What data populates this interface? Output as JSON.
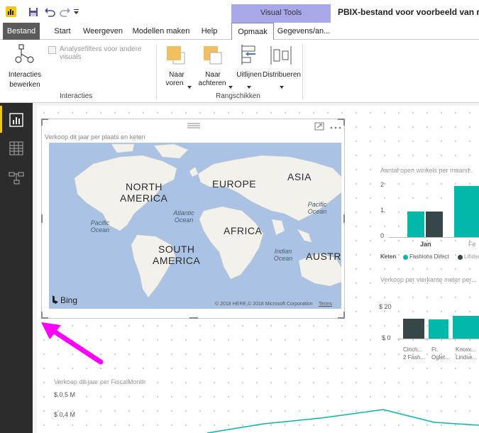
{
  "quick_access": {
    "app_icon": "power-bi-icon",
    "icons": [
      "save-icon",
      "undo-icon",
      "redo-icon",
      "customize-icon"
    ]
  },
  "context_group": {
    "label": "Visual Tools"
  },
  "window": {
    "title": "PBIX-bestand voor voorbeeld van reti"
  },
  "tabs": [
    {
      "label": "Bestand"
    },
    {
      "label": "Start"
    },
    {
      "label": "Weergeven"
    },
    {
      "label": "Modellen maken"
    },
    {
      "label": "Help"
    },
    {
      "label": "Opmaak"
    },
    {
      "label": "Gegevens/an..."
    }
  ],
  "ribbon": {
    "interacties": {
      "button_line1": "Interacties",
      "button_line2": "bewerken",
      "checkbox_label": "Analysefilters voor andere visuals",
      "group": "Interacties"
    },
    "rangschikken": {
      "naar_voren_1": "Naar",
      "naar_voren_2": "voren",
      "naar_achteren_1": "Naar",
      "naar_achteren_2": "achteren",
      "uitlijnen": "Uitlijnen",
      "distribueren": "Distribueren",
      "group": "Rangschikken"
    }
  },
  "nav": {
    "icons": [
      "report-icon",
      "data-icon",
      "relationships-icon"
    ]
  },
  "map_visual": {
    "title": "Verkoop dit jaar per plaats en keten",
    "continents": [
      "NORTH",
      "AMERICA",
      "EUROPE",
      "ASIA",
      "AFRICA",
      "SOUTH",
      "AMERICA",
      "AUSTRA"
    ],
    "oceans": {
      "pacific_1": "Pacific",
      "pacific_2": "Ocean",
      "pacific_b1": "Pacific",
      "pacific_b2": "Ocean",
      "atlantic_1": "Atlantic",
      "atlantic_2": "Ocean",
      "indian_1": "Indian",
      "indian_2": "Ocean"
    },
    "bing": "Bing",
    "copyright": "© 2018 HERE,© 2018 Microsoft Corporation",
    "terms": "Terms"
  },
  "chart1": {
    "title": "Aantal open winkels per maand..",
    "yticks": [
      "2",
      "1",
      "0"
    ],
    "xlabel_jan": "Jan",
    "xlabel_feb": "Fe",
    "legend_label": "Keten",
    "legend": [
      "Fashions Direct",
      "Lindseys"
    ]
  },
  "chart2": {
    "title": "Verkoop per vierkante meter per...",
    "yticks": [
      "$ 20",
      "$ 0"
    ],
    "cats": [
      [
        "Cinch...",
        "2 Fash..."
      ],
      [
        "Ft.",
        "Oglet..."
      ],
      [
        "Knoxv...",
        "Lindse..."
      ]
    ]
  },
  "chart3": {
    "title": "Verkoop dit jaar per FiscalMonth",
    "yticks": [
      "$ 0,5 M",
      "$ 0,4 M"
    ]
  },
  "colors": {
    "teal": "#01b8aa",
    "dark": "#374649",
    "accent": "#f2c80f",
    "pink": "#ff00ff",
    "context": "#a8a8e8"
  }
}
